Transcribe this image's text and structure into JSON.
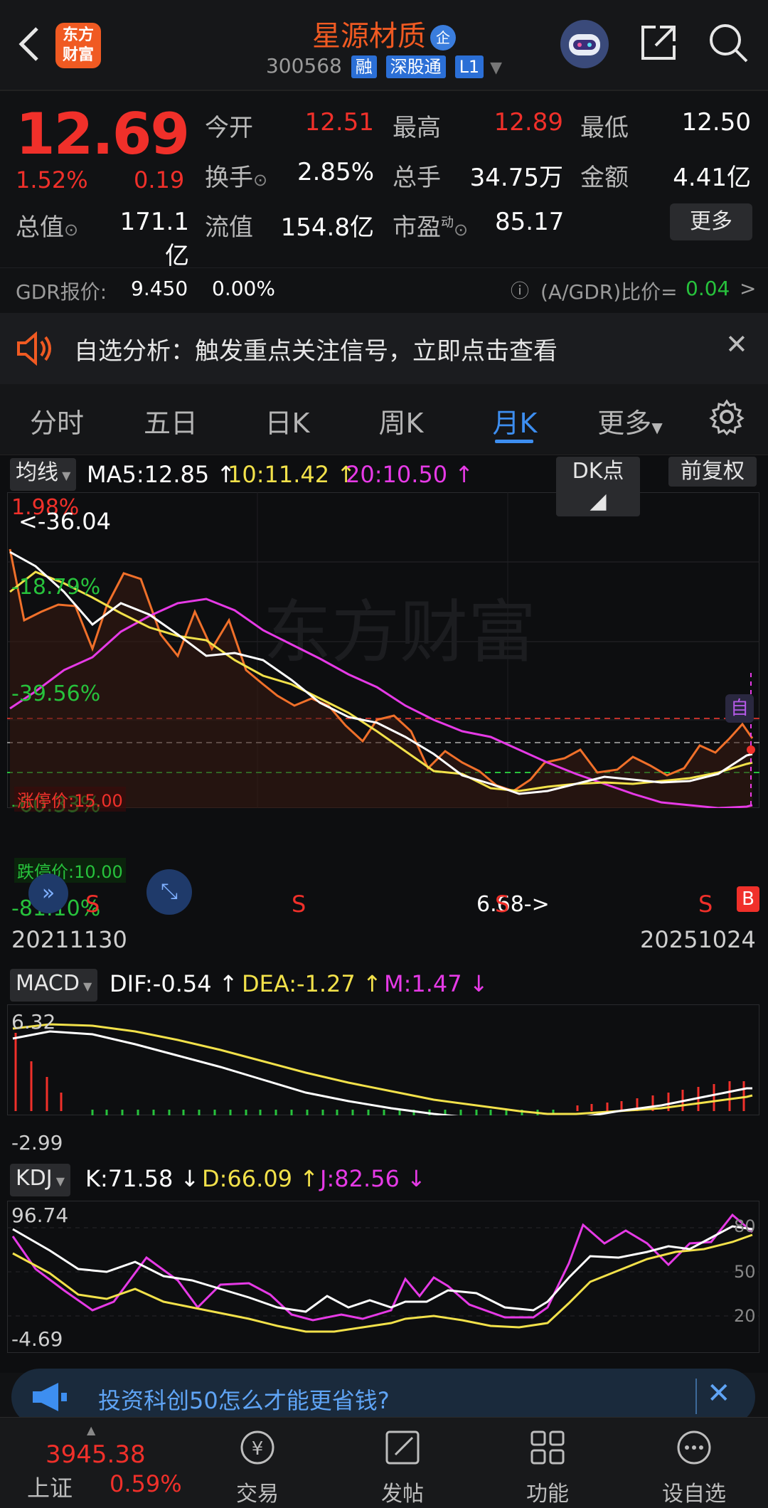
{
  "header": {
    "logo_text": "东方财富",
    "title": "星源材质",
    "badge": "企",
    "code": "300568",
    "tags": [
      "融",
      "深股通",
      "L1"
    ]
  },
  "quote": {
    "price": "12.69",
    "change_pct": "1.52%",
    "change": "0.19",
    "open_label": "今开",
    "open": "12.51",
    "high_label": "最高",
    "high": "12.89",
    "low_label": "最低",
    "low": "12.50",
    "turnover_label": "换手",
    "turnover": "2.85%",
    "volume_label": "总手",
    "volume": "34.75万",
    "amount_label": "金额",
    "amount": "4.41亿",
    "mktcap_label": "总值",
    "mktcap": "171.1亿",
    "float_label": "流值",
    "float": "154.8亿",
    "pe_label": "市盈",
    "pe_sup": "动",
    "pe": "85.17",
    "more_label": "更多"
  },
  "gdr": {
    "label": "GDR报价:",
    "price": "9.450",
    "change": "0.00%",
    "ratio_label": "(A/GDR)比价=",
    "ratio": "0.04",
    "chevron": ">"
  },
  "notice": {
    "text": "自选分析：触发重点关注信号，立即点击查看",
    "close": "✕"
  },
  "tabs": [
    "分时",
    "五日",
    "日K",
    "周K",
    "月K",
    "更多"
  ],
  "active_tab": 4,
  "kline": {
    "indicator_select": "均线",
    "ma5": "MA5:12.85",
    "ma10": "10:11.42",
    "ma20": "20:10.50",
    "dk_label": "DK点",
    "adjust_label": "前复权",
    "top_pct": "1.98%",
    "max_label": "<-36.04",
    "pct_labels": [
      "-18.79%",
      "-39.56%",
      "-60.33%",
      "-81.10%"
    ],
    "limit_up": "涨停价:15.00",
    "limit_down": "跌停价:10.00",
    "min_label": "6.68->",
    "self_badge": "自",
    "buy_badge": "B",
    "sell_marks": [
      "S",
      "S",
      "S",
      "S"
    ],
    "date_start": "20211130",
    "date_end": "20251024",
    "watermark": "东方财富"
  },
  "macd": {
    "select": "MACD",
    "dif": "DIF:-0.54",
    "dea": "DEA:-1.27",
    "m": "M:1.47",
    "max": "6.32",
    "min": "-2.99"
  },
  "kdj": {
    "select": "KDJ",
    "k": "K:71.58",
    "d": "D:66.09",
    "j": "J:82.56",
    "max": "96.74",
    "min": "-4.69",
    "levels": [
      "80",
      "50",
      "20"
    ]
  },
  "promo": {
    "text": "投资科创50怎么才能更省钱?"
  },
  "nav": {
    "index_value": "3945.38",
    "index_name": "上证",
    "index_change": "0.59%",
    "items": [
      "交易",
      "发帖",
      "功能",
      "设自选"
    ]
  },
  "colors": {
    "up": "#f0302a",
    "down": "#27c23c",
    "accent": "#3d8ef0",
    "ma5": "#ffffff",
    "ma10": "#f2e14a",
    "ma20": "#e63ae6",
    "price_line": "#f0702a"
  }
}
